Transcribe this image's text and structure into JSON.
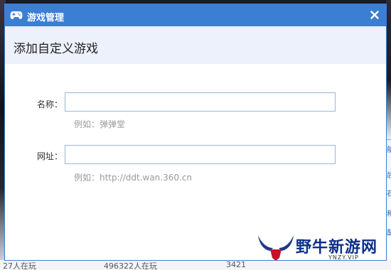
{
  "dialog": {
    "title": "游戏管理",
    "heading": "添加自定义游戏",
    "close_glyph": "✕"
  },
  "form": {
    "name_label": "名称：",
    "name_value": "",
    "name_hint": "例如：弹弹堂",
    "url_label": "网址：",
    "url_value": "",
    "url_hint": "例如：http://ddt.wan.360.cn"
  },
  "background": {
    "bottom_texts": [
      "27人在玩",
      "496322人在玩",
      "3421"
    ],
    "right_fragments": [
      "船",
      "后",
      "石",
      "和",
      "配"
    ]
  },
  "watermark": {
    "brand": "野牛新游网",
    "domain": "YNZY.VIP"
  },
  "colors": {
    "titlebar": "#3b7fd4",
    "header_bg": "#edf1fb",
    "input_border": "#9cb6d6",
    "hint": "#9a9a9a"
  },
  "icons": {
    "app": "gamepad-icon",
    "close": "close-icon",
    "watermark": "bull-horns-icon"
  }
}
